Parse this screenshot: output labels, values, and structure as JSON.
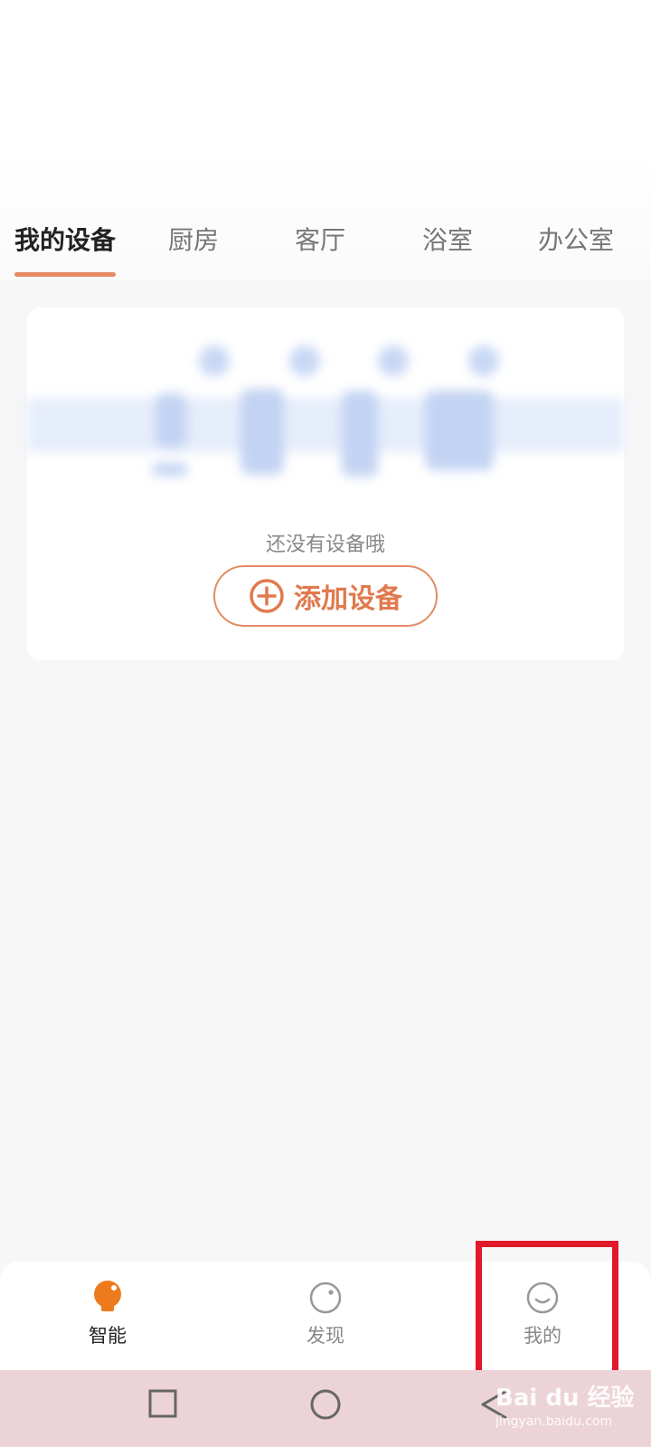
{
  "tabs": [
    {
      "label": "我的设备",
      "active": true
    },
    {
      "label": "厨房",
      "active": false
    },
    {
      "label": "客厅",
      "active": false
    },
    {
      "label": "浴室",
      "active": false
    },
    {
      "label": "办公室",
      "active": false
    }
  ],
  "empty_state": {
    "message": "还没有设备哦",
    "add_button_label": "添加设备",
    "add_icon": "plus-circle-icon"
  },
  "bottom_nav": [
    {
      "label": "智能",
      "icon": "bulb-icon",
      "active": true
    },
    {
      "label": "发现",
      "icon": "discover-icon",
      "active": false
    },
    {
      "label": "我的",
      "icon": "profile-icon",
      "active": false
    }
  ],
  "system_nav": {
    "icons": [
      "recent-apps-icon",
      "home-icon",
      "back-icon"
    ]
  },
  "watermark": {
    "logo": "Bai du 经验",
    "url": "jingyan.baidu.com"
  },
  "colors": {
    "accent": "#e07a4e",
    "highlight": "#e01a2a",
    "system_bar": "#ecd3d8"
  }
}
